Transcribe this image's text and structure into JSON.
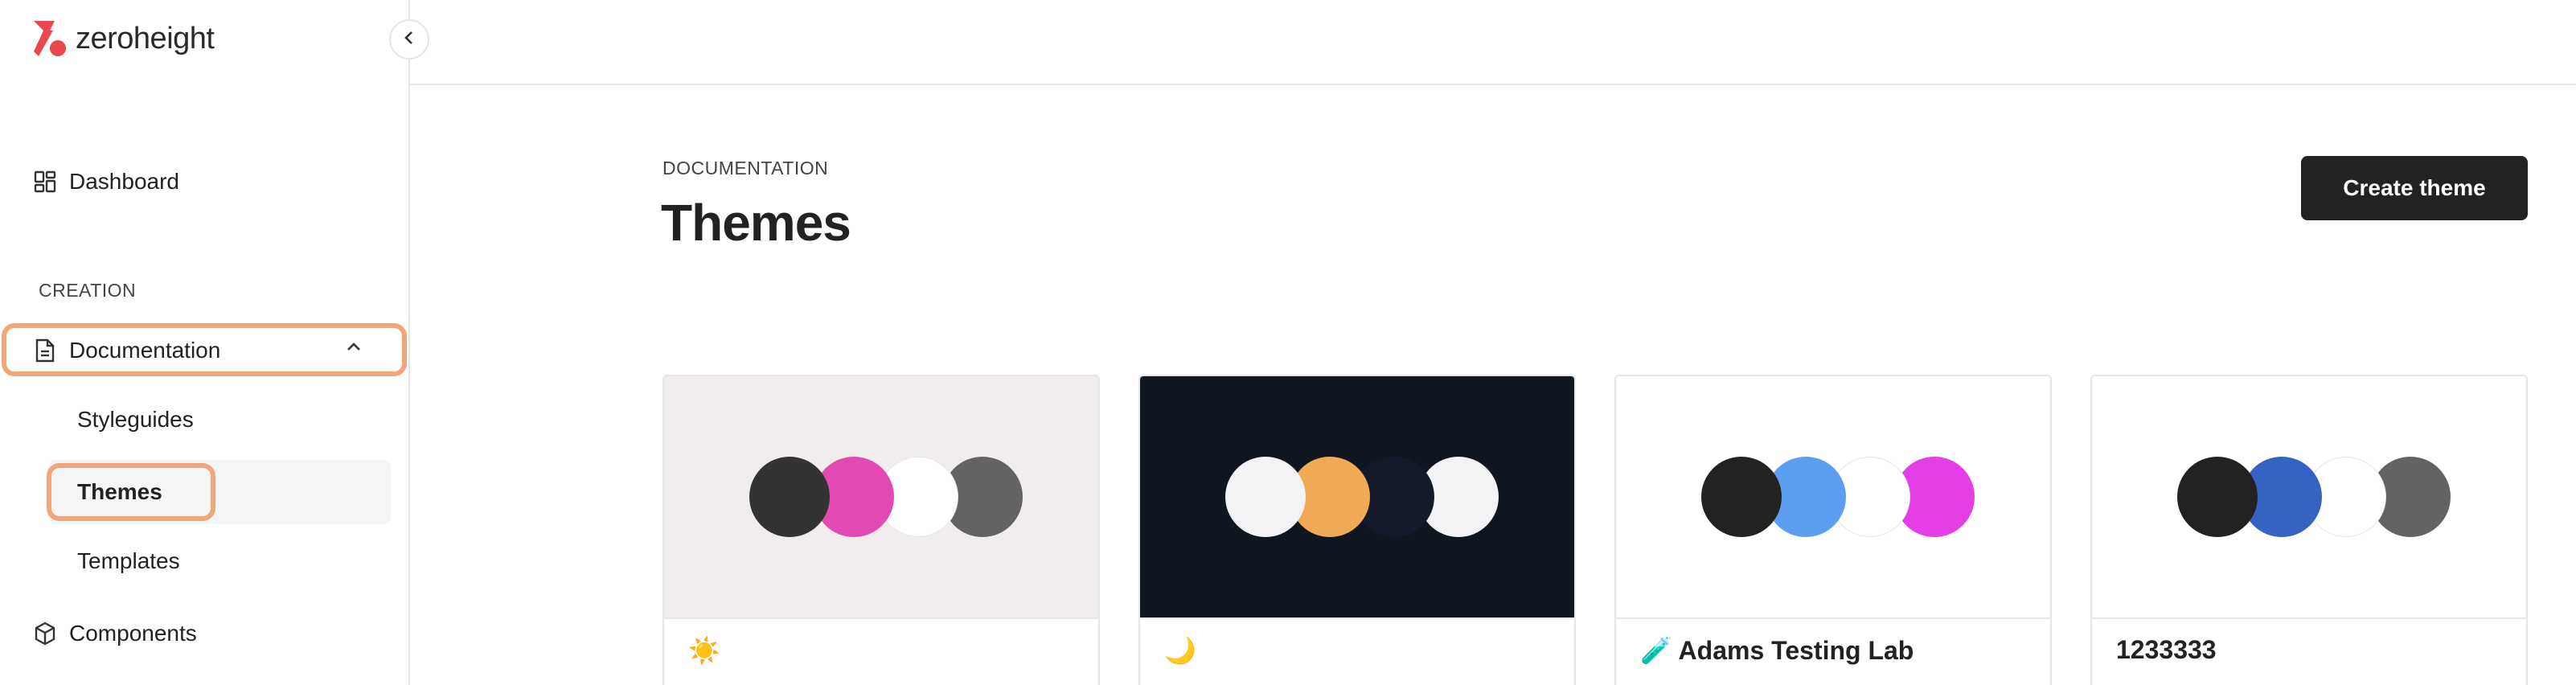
{
  "app": {
    "logo_text": "zeroheight"
  },
  "sidebar": {
    "dashboard_label": "Dashboard",
    "section_label": "CREATION",
    "documentation_label": "Documentation",
    "sub_items": {
      "styleguides": "Styleguides",
      "themes": "Themes",
      "templates": "Templates"
    },
    "components_label": "Components"
  },
  "main": {
    "breadcrumb": "DOCUMENTATION",
    "title": "Themes",
    "create_button": "Create theme",
    "themes": [
      {
        "name": "☀️",
        "preview_bg": "#f2eded",
        "swatches": [
          "#333333",
          "#e24ab1",
          "#ffffff",
          "#636363"
        ]
      },
      {
        "name": "🌙",
        "preview_bg": "#0f1620",
        "swatches": [
          "#f3f3f6",
          "#f0a954",
          "#151a2b",
          "#f3f3f6"
        ]
      },
      {
        "name": "🧪 Adams Testing Lab",
        "preview_bg": "#ffffff",
        "swatches": [
          "#222222",
          "#5c9ff0",
          "#ffffff",
          "#e63ee6"
        ]
      },
      {
        "name": "1233333",
        "preview_bg": "#ffffff",
        "swatches": [
          "#222222",
          "#3563c4",
          "#ffffff",
          "#636363"
        ]
      }
    ]
  },
  "colors": {
    "highlight": "#f0a57a",
    "logo": "#e8484e",
    "primary_button": "#222222"
  }
}
